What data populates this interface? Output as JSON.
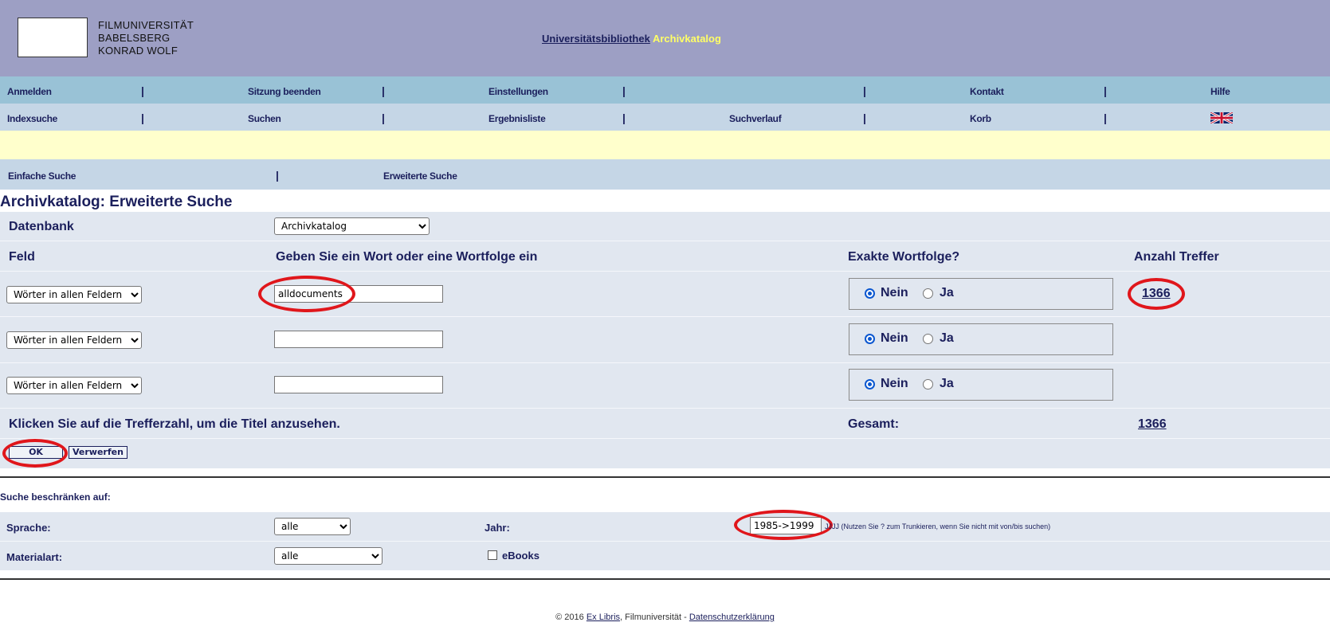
{
  "header": {
    "logo_lines": [
      "FILMUNIVERSITÄT",
      "BABELSBERG",
      "KONRAD WOLF"
    ],
    "link_ub": "Universitätsbibliothek",
    "link_archiv": "Archivkatalog"
  },
  "nav1": [
    "Anmelden",
    "Sitzung beenden",
    "Einstellungen",
    "",
    "Kontakt",
    "Hilfe"
  ],
  "nav2": [
    "Indexsuche",
    "Suchen",
    "Ergebnisliste",
    "Suchverlauf",
    "Korb"
  ],
  "nav_separator": "|",
  "tabs": [
    "Einfache Suche",
    "Erweiterte Suche"
  ],
  "page_title": "Archivkatalog: Erweiterte Suche",
  "form": {
    "datenbank_label": "Datenbank",
    "datenbank_value": "Archivkatalog",
    "feld_header": "Feld",
    "wort_header": "Geben Sie ein Wort oder eine Wortfolge ein",
    "exakt_header": "Exakte Wortfolge?",
    "treffer_header": "Anzahl Treffer",
    "rows": [
      {
        "feld": "Wörter in allen Feldern",
        "value": "alldocuments",
        "exact": "Nein",
        "hits": "1366"
      },
      {
        "feld": "Wörter in allen Feldern",
        "value": "",
        "exact": "Nein",
        "hits": ""
      },
      {
        "feld": "Wörter in allen Feldern",
        "value": "",
        "exact": "Nein",
        "hits": ""
      }
    ],
    "radio_no": "Nein",
    "radio_yes": "Ja",
    "hint": "Klicken Sie auf die Trefferzahl, um die Titel anzusehen.",
    "gesamt_label": "Gesamt:",
    "gesamt_value": "1366",
    "ok_button": "OK",
    "reset_button": "Verwerfen"
  },
  "restrict": {
    "title": "Suche beschränken auf:",
    "sprache_label": "Sprache:",
    "sprache_value": "alle",
    "jahr_label": "Jahr:",
    "jahr_value": "1985->1999",
    "jahr_hint": "JJJJ (Nutzen Sie ? zum Trunkieren, wenn Sie nicht mit von/bis suchen)",
    "materialart_label": "Materialart:",
    "materialart_value": "alle",
    "ebooks_label": "eBooks"
  },
  "footer": {
    "copyright": "© 2016",
    "exlibris": "Ex Libris",
    "middle": ", Filmuniversität - ",
    "datenschutz": "Datenschutzerklärung"
  },
  "colors": {
    "header_bg": "#9d9fc4",
    "nav1_bg": "#99c2d6",
    "nav2_bg": "#c5d6e6",
    "notice_bg": "#ffffcc",
    "form_bg": "#e1e7f0",
    "text": "#1b1f5c",
    "highlight_ellipse": "#e0161b"
  },
  "icons": {
    "language_flag": "uk-flag-icon"
  }
}
